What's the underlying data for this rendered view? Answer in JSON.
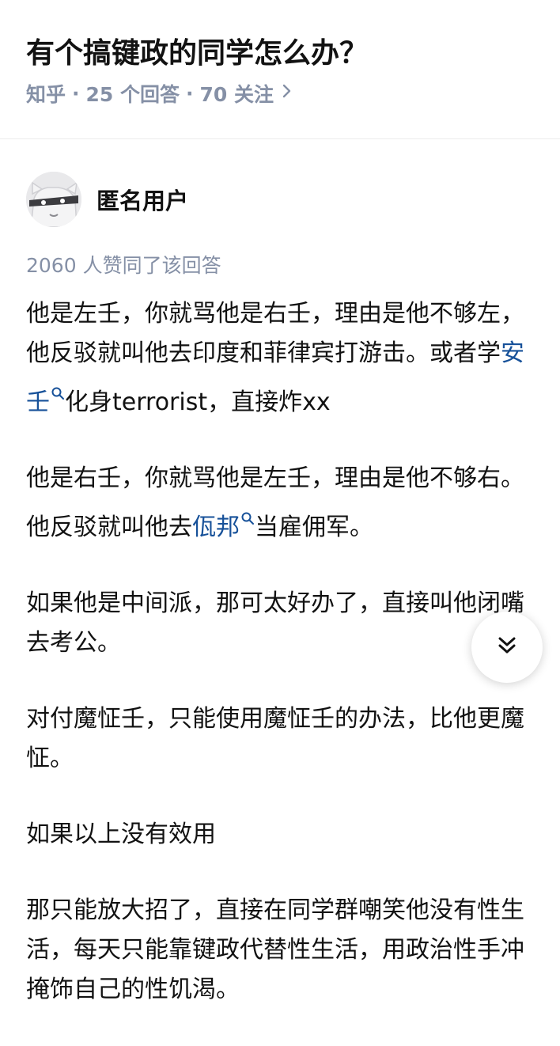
{
  "question": {
    "title": "有个搞键政的同学怎么办？",
    "source": "知乎",
    "answers_count": "25 个回答",
    "followers": "70 关注",
    "separator": "·"
  },
  "answer": {
    "author_name": "匿名用户",
    "vote_text": "2060 人赞同了该回答",
    "paragraphs": {
      "p1": {
        "before": "他是左壬，你就骂他是右壬，理由是他不够左，他反驳就叫他去印度和菲律宾打游击。或者学",
        "link": "安壬",
        "after": "化身terrorist，直接炸xx"
      },
      "p2": {
        "before": "他是右壬，你就骂他是左壬，理由是他不够右。他反驳就叫他去",
        "link": "佤邦",
        "after": "当雇佣军。"
      },
      "p3": "如果他是中间派，那可太好办了，直接叫他闭嘴去考公。",
      "p4": "对付魔怔壬，只能使用魔怔壬的办法，比他更魔怔。",
      "p5": "如果以上没有效用",
      "p6": "那只能放大招了，直接在同学群嘲笑他没有性生活，每天只能靠键政代替性生活，用政治性手冲掩饰自己的性饥渴。"
    }
  },
  "icons": {
    "meta_chevron": "chevron-right-icon",
    "link_search": "search-icon",
    "scroll_button": "double-chevron-down-icon",
    "avatar": "anonymous-avatar-icon"
  },
  "colors": {
    "link": "#175199",
    "meta": "#8590a6",
    "text": "#121212"
  }
}
